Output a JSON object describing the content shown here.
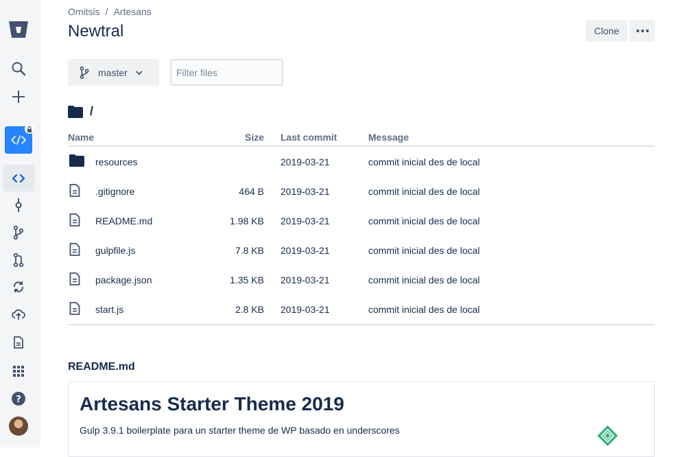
{
  "breadcrumb": {
    "workspace": "Omitsis",
    "separator": "/",
    "project": "Artesans"
  },
  "repo": {
    "name": "Newtral"
  },
  "actions": {
    "clone_label": "Clone"
  },
  "branch": {
    "name": "master"
  },
  "filter": {
    "placeholder": "Filter files",
    "value": ""
  },
  "path": {
    "current": "/"
  },
  "table": {
    "headers": {
      "name": "Name",
      "size": "Size",
      "last_commit": "Last commit",
      "message": "Message"
    },
    "rows": [
      {
        "type": "folder",
        "name": "resources",
        "size": "",
        "date": "2019-03-21",
        "message": "commit inicial des de local"
      },
      {
        "type": "file",
        "name": ".gitignore",
        "size": "464 B",
        "date": "2019-03-21",
        "message": "commit inicial des de local"
      },
      {
        "type": "file",
        "name": "README.md",
        "size": "1.98 KB",
        "date": "2019-03-21",
        "message": "commit inicial des de local"
      },
      {
        "type": "file",
        "name": "gulpfile.js",
        "size": "7.8 KB",
        "date": "2019-03-21",
        "message": "commit inicial des de local"
      },
      {
        "type": "file",
        "name": "package.json",
        "size": "1.35 KB",
        "date": "2019-03-21",
        "message": "commit inicial des de local"
      },
      {
        "type": "file",
        "name": "start.js",
        "size": "2.8 KB",
        "date": "2019-03-21",
        "message": "commit inicial des de local"
      }
    ]
  },
  "readme": {
    "section_title": "README.md",
    "heading": "Artesans Starter Theme 2019",
    "paragraph": "Gulp 3.9.1 boilerplate para un starter theme de WP basado en underscores"
  },
  "colors": {
    "accent": "#2684ff",
    "text": "#172b4d",
    "muted": "#5e6c84",
    "sidebar": "#f4f5f7",
    "badge": "#36b37e"
  }
}
